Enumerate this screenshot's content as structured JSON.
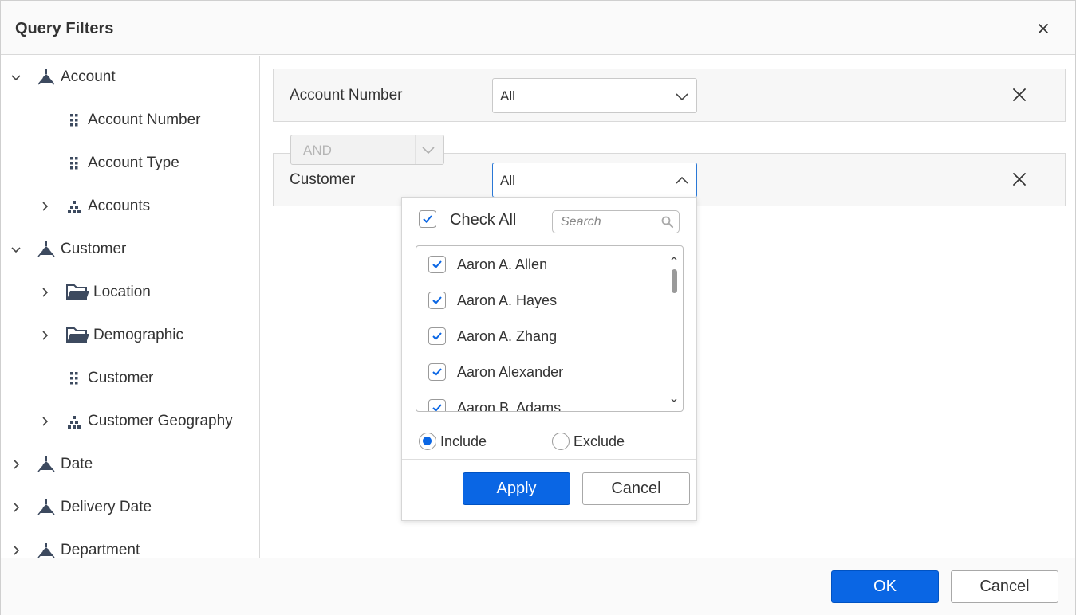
{
  "dialog": {
    "title": "Query Filters"
  },
  "tree": {
    "items": [
      {
        "label": "Account",
        "level": 0,
        "expander": "expanded",
        "icon": "dimension-icon"
      },
      {
        "label": "Account Number",
        "level": 1,
        "expander": "none",
        "icon": "attribute-icon"
      },
      {
        "label": "Account Type",
        "level": 1,
        "expander": "none",
        "icon": "attribute-icon"
      },
      {
        "label": "Accounts",
        "level": 1,
        "expander": "collapsed",
        "icon": "hierarchy-icon"
      },
      {
        "label": "Customer",
        "level": 0,
        "expander": "expanded",
        "icon": "dimension-icon"
      },
      {
        "label": "Location",
        "level": 1,
        "expander": "collapsed",
        "icon": "folder-icon"
      },
      {
        "label": "Demographic",
        "level": 1,
        "expander": "collapsed",
        "icon": "folder-icon"
      },
      {
        "label": "Customer",
        "level": 1,
        "expander": "none",
        "icon": "attribute-icon"
      },
      {
        "label": "Customer Geography",
        "level": 1,
        "expander": "collapsed",
        "icon": "hierarchy-icon"
      },
      {
        "label": "Date",
        "level": 0,
        "expander": "collapsed",
        "icon": "dimension-icon"
      },
      {
        "label": "Delivery Date",
        "level": 0,
        "expander": "collapsed",
        "icon": "dimension-icon"
      },
      {
        "label": "Department",
        "level": 0,
        "expander": "collapsed",
        "icon": "dimension-icon"
      }
    ]
  },
  "conditions": [
    {
      "label": "Account Number",
      "value": "All"
    },
    {
      "label": "Customer",
      "value": "All"
    }
  ],
  "operator": {
    "value": "AND"
  },
  "popup": {
    "check_all_label": "Check All",
    "search_placeholder": "Search",
    "items": [
      {
        "name": "Aaron A. Allen",
        "checked": true
      },
      {
        "name": "Aaron A. Hayes",
        "checked": true
      },
      {
        "name": "Aaron A. Zhang",
        "checked": true
      },
      {
        "name": "Aaron Alexander",
        "checked": true
      },
      {
        "name": "Aaron B. Adams",
        "checked": true
      }
    ],
    "include_label": "Include",
    "exclude_label": "Exclude",
    "mode": "include",
    "apply_label": "Apply",
    "cancel_label": "Cancel"
  },
  "footer": {
    "ok_label": "OK",
    "cancel_label": "Cancel"
  },
  "colors": {
    "accent": "#0a66e4",
    "icon": "#3d4a5f",
    "text": "#333333"
  }
}
